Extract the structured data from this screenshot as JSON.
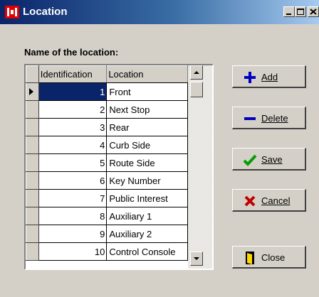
{
  "window": {
    "title": "Location"
  },
  "form": {
    "caption": "Name of the location:"
  },
  "grid": {
    "columns": [
      "Identification",
      "Location"
    ],
    "selected_row": 0,
    "rows": [
      {
        "id": "1",
        "location": "Front"
      },
      {
        "id": "2",
        "location": "Next Stop"
      },
      {
        "id": "3",
        "location": "Rear"
      },
      {
        "id": "4",
        "location": "Curb Side"
      },
      {
        "id": "5",
        "location": "Route Side"
      },
      {
        "id": "6",
        "location": "Key Number"
      },
      {
        "id": "7",
        "location": "Public Interest"
      },
      {
        "id": "8",
        "location": "Auxiliary 1"
      },
      {
        "id": "9",
        "location": "Auxiliary 2"
      },
      {
        "id": "10",
        "location": "Control Console"
      }
    ]
  },
  "buttons": {
    "add": {
      "label": "Add",
      "icon": "plus-icon",
      "color": "#0000c0"
    },
    "delete": {
      "label": "Delete",
      "icon": "minus-icon",
      "color": "#0000c0"
    },
    "save": {
      "label": "Save",
      "icon": "checkmark-icon",
      "color": "#00a000"
    },
    "cancel": {
      "label": "Cancel",
      "icon": "x-icon",
      "color": "#c00000"
    },
    "close": {
      "label": "Close",
      "icon": "door-icon",
      "color": "#ffd700"
    }
  },
  "colors": {
    "titlebar": "#0a246a",
    "face": "#d4d0c8",
    "selection": "#0a246a"
  }
}
